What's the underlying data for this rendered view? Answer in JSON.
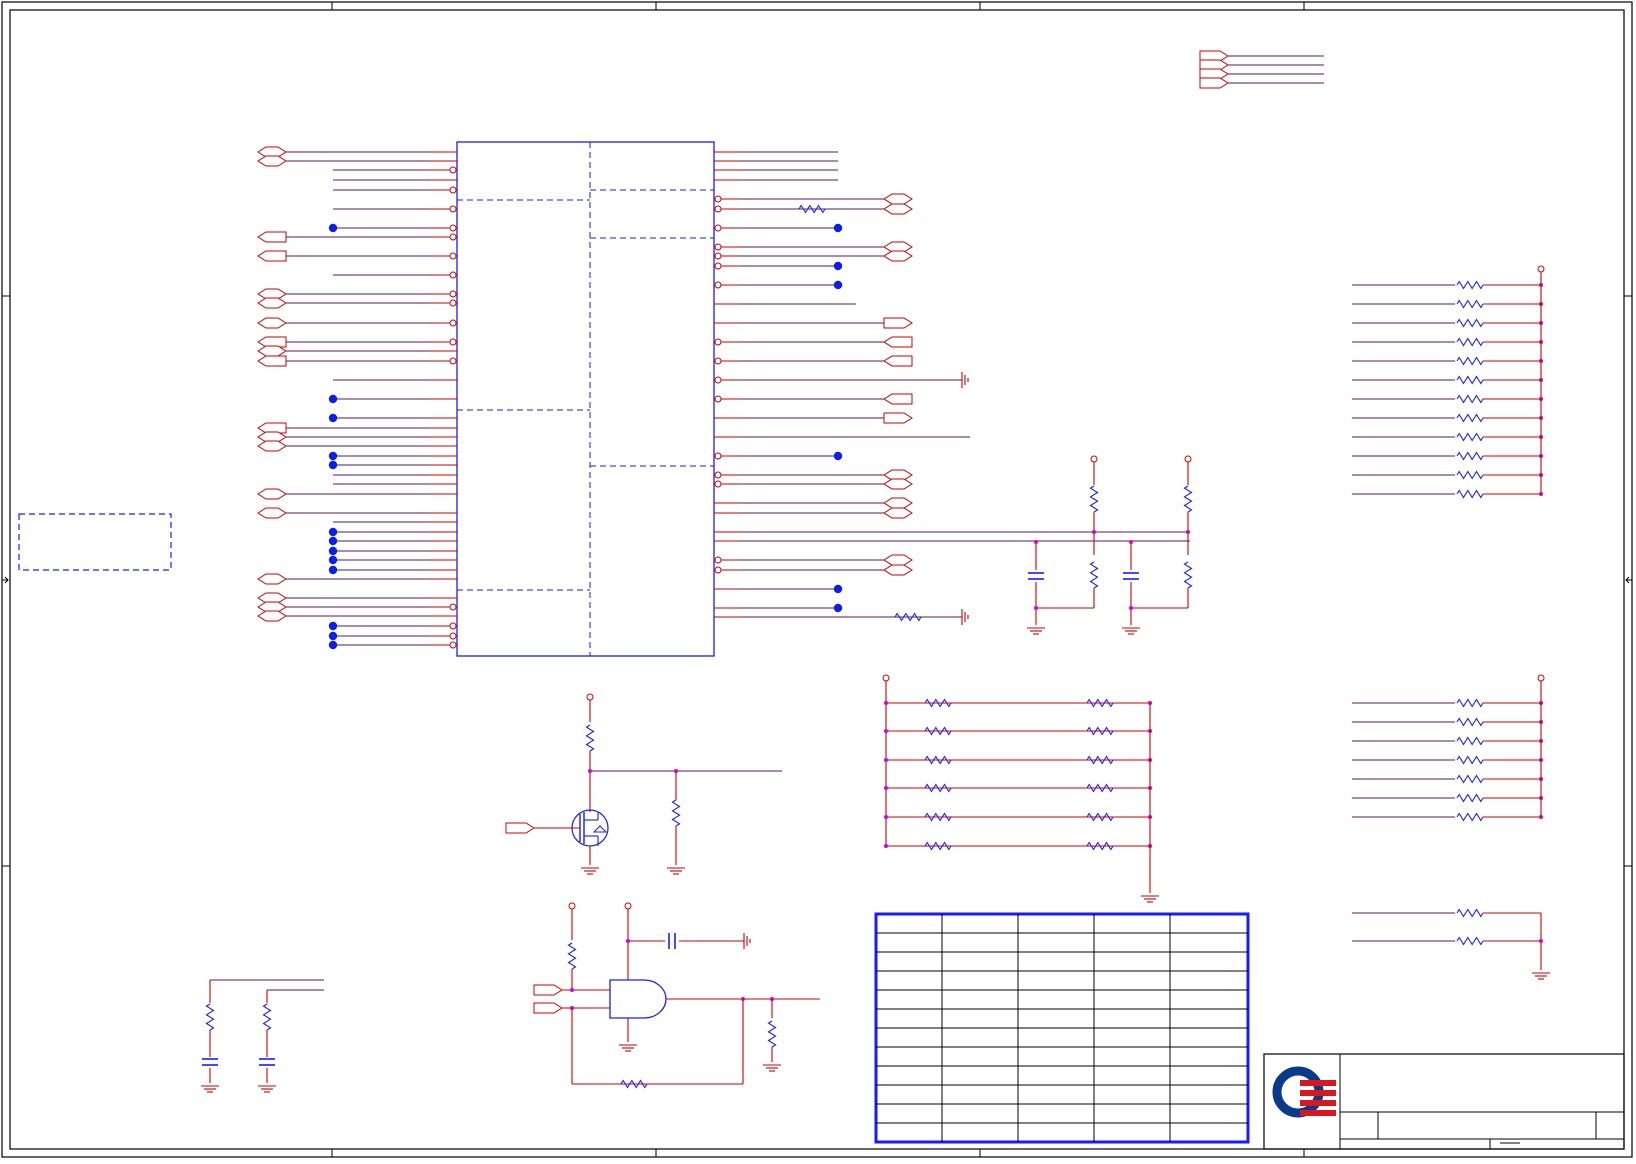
{
  "colors": {
    "wire": "#cc0000",
    "net": "#5a1a5a",
    "component": "#1a1aff",
    "junction": "#0b1fe8",
    "pin": "#d400d4",
    "logo_blue": "#0a3a8c",
    "logo_red": "#d7181f"
  },
  "symbols": {
    "ic": "ic-package",
    "mosfet": "n-channel-mosfet",
    "gate": "and-gate",
    "resistor": "resistor",
    "capacitor": "capacitor",
    "ground": "ground-symbol",
    "logo": "quanta-logo"
  },
  "tables": {
    "revision_rows": 12,
    "revision_cols": 5
  }
}
